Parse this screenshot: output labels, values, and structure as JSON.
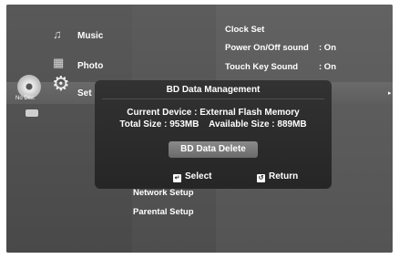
{
  "left_menu": {
    "items": [
      {
        "label": "Music",
        "icon": "music-note-icon"
      },
      {
        "label": "Photo",
        "icon": "photo-icon"
      },
      {
        "label": "Set",
        "icon": "gear-icon"
      }
    ],
    "disc_label": "No Disc"
  },
  "mid_menu": {
    "items": [
      "Network Setup",
      "Parental Setup"
    ]
  },
  "right_menu": {
    "items": [
      {
        "label": "Clock Set",
        "value": ""
      },
      {
        "label": "Power On/Off sound",
        "value": ":  On"
      },
      {
        "label": "Touch Key Sound",
        "value": ":  On"
      }
    ],
    "arrow": "▸"
  },
  "dialog": {
    "title": "BD Data Management",
    "current_device": "Current Device : External Flash Memory",
    "sizes": "Total Size : 953MB    Available Size : 889MB",
    "button": "BD Data Delete",
    "footer": {
      "select": "Select",
      "return": "Return"
    }
  }
}
